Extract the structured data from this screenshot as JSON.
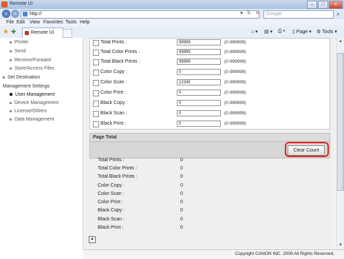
{
  "window": {
    "title": "Remote UI"
  },
  "address": {
    "url": "http://",
    "search_placeholder": "Google"
  },
  "menu": [
    "File",
    "Edit",
    "View",
    "Favorites",
    "Tools",
    "Help"
  ],
  "tab": {
    "label": "Remote UI"
  },
  "toolbar": {
    "page_label": "Page",
    "tools_label": "Tools"
  },
  "sidebar": {
    "items": [
      {
        "label": "Printer",
        "level": "sub"
      },
      {
        "label": "Send",
        "level": "sub"
      },
      {
        "label": "Receive/Forward",
        "level": "sub"
      },
      {
        "label": "Store/Access Files",
        "level": "sub"
      },
      {
        "label": "Set Destination",
        "level": "top"
      },
      {
        "label": "Management Settings",
        "level": "header"
      },
      {
        "label": "User Management",
        "level": "sub",
        "active": true
      },
      {
        "label": "Device Management",
        "level": "sub"
      },
      {
        "label": "License/Others",
        "level": "sub"
      },
      {
        "label": "Data Management",
        "level": "sub"
      }
    ]
  },
  "limits": {
    "rows": [
      {
        "label": "Total Prints :",
        "value": "99999",
        "range": "(0-999999)"
      },
      {
        "label": "Total Color Prints :",
        "value": "99999",
        "range": "(0-999999)"
      },
      {
        "label": "Total Black Prints :",
        "value": "99999",
        "range": "(0-999999)"
      },
      {
        "label": "Color Copy :",
        "value": "0",
        "range": "(0-999999)"
      },
      {
        "label": "Color Scan :",
        "value": "12345",
        "range": "(0-999999)"
      },
      {
        "label": "Color Print :",
        "value": "0",
        "range": "(0-999999)"
      },
      {
        "label": "Black Copy :",
        "value": "0",
        "range": "(0-999999)"
      },
      {
        "label": "Black Scan :",
        "value": "0",
        "range": "(0-999999)"
      },
      {
        "label": "Black Print :",
        "value": "0",
        "range": "(0-999999)"
      }
    ]
  },
  "page_total": {
    "title": "Page Total",
    "clear_button": "Clear Count",
    "rows": [
      {
        "label": "Total Prints :",
        "value": "0"
      },
      {
        "label": "Total Color Prints :",
        "value": "0"
      },
      {
        "label": "Total Black Prints :",
        "value": "0"
      },
      {
        "label": "Color Copy :",
        "value": "0"
      },
      {
        "label": "Color Scan :",
        "value": "0"
      },
      {
        "label": "Color Print :",
        "value": "0"
      },
      {
        "label": "Black Copy :",
        "value": "0"
      },
      {
        "label": "Black Scan :",
        "value": "0"
      },
      {
        "label": "Black Print :",
        "value": "0"
      }
    ]
  },
  "footer": {
    "copyright": "Copyright CANON INC. 2009 All Rights Reserved."
  },
  "colors": {
    "highlight": "#e01e1e",
    "active_bullet": "#223344"
  }
}
